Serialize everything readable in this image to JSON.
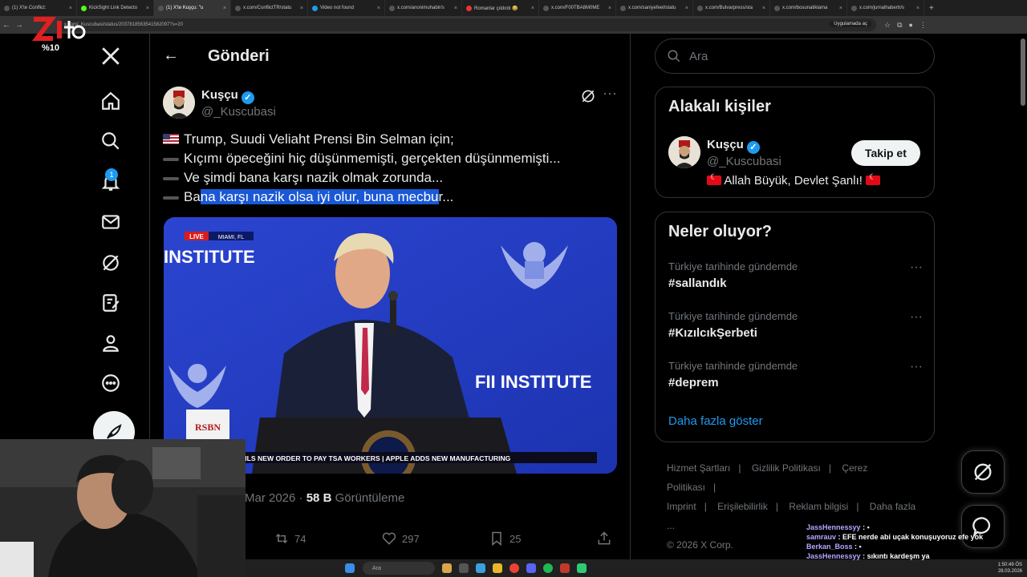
{
  "browser": {
    "tabs": [
      {
        "label": "(1) X'te Conflict:",
        "color": "#555",
        "active": false
      },
      {
        "label": "KickSight Link Detecto",
        "color": "#53fc18",
        "active": false
      },
      {
        "label": "(1) X'te Kuşçu: \"u",
        "color": "#555",
        "active": true
      },
      {
        "label": "x.com/ConflictTR/statu",
        "color": "#555",
        "active": false
      },
      {
        "label": "Video not found",
        "color": "#1d9bf0",
        "active": false
      },
      {
        "label": "x.com/anonimuhabir/s",
        "color": "#555",
        "active": false
      },
      {
        "label": "Romanlar çıldırdı 😂",
        "color": "#e33",
        "active": false
      },
      {
        "label": "x.com/F00TBA8M0ME",
        "color": "#555",
        "active": false
      },
      {
        "label": "x.com/saniyefeel/statu",
        "color": "#555",
        "active": false
      },
      {
        "label": "x.com/Bulvarpress/sta",
        "color": "#555",
        "active": false
      },
      {
        "label": "x.com/bosunatiklama",
        "color": "#555",
        "active": false
      },
      {
        "label": "x.com/jurnalhabertr/s",
        "color": "#555",
        "active": false
      }
    ],
    "url": "x.com/_Kuscubasi/status/2037818563541582097?s=20",
    "open_in_app": "Uygulamada aç"
  },
  "overlay": {
    "logo_text": "%10"
  },
  "nav": {
    "badge_count": "1"
  },
  "header": {
    "title": "Gönderi"
  },
  "tweet": {
    "author_name": "Kuşçu",
    "author_handle": "@_Kuscubasi",
    "lines": [
      "Trump, Suudi Veliaht Prensi Bin Selman için;",
      "Kıçımı öpeceğini hiç düşünmemişti, gerçekten düşünmemişti...",
      "Ve şimdi bana karşı nazik olmak zorunda...",
      "Bana karşı nazik olsa iyi olur, buna mecbur..."
    ],
    "last_line_plain_start": "Ba",
    "last_line_highlight": "na karşı nazik olsa iyi olur, buna mecbu",
    "last_line_plain_end": "r...",
    "date_partial": "Mar 2026 ·",
    "views_count": "58 B",
    "views_label": "Görüntüleme",
    "retweets": "74",
    "likes": "297",
    "bookmarks": "25",
    "media": {
      "live_tag": "LIVE",
      "location": "MIAMI, FL",
      "logo_left": "INSTITUTE",
      "logo_right": "FII INSTITUTE",
      "rsbn": "RSBN",
      "ticker": "ESIDENT TRUMP UNVEILS NEW ORDER TO PAY TSA WORKERS | APPLE ADDS NEW MANUFACTURING"
    }
  },
  "sidebar": {
    "search_placeholder": "Ara",
    "relevant": {
      "title": "Alakalı kişiler",
      "name": "Kuşçu",
      "handle": "@_Kuscubasi",
      "bio": "Allah Büyük, Devlet Şanlı!",
      "follow_label": "Takip et"
    },
    "trends": {
      "title": "Neler oluyor?",
      "items": [
        {
          "context": "Türkiye tarihinde gündemde",
          "tag": "#sallandık"
        },
        {
          "context": "Türkiye tarihinde gündemde",
          "tag": "#KızılcıkŞerbeti"
        },
        {
          "context": "Türkiye tarihinde gündemde",
          "tag": "#deprem"
        }
      ],
      "more": "Daha fazla göster"
    },
    "footer": [
      "Hizmet Şartları",
      "Gizlilik Politikası",
      "Çerez Politikası",
      "Imprint",
      "Erişilebilirlik",
      "Reklam bilgisi",
      "Daha fazla ...",
      "© 2026 X Corp."
    ]
  },
  "chat": [
    {
      "user": "JassHennessyy",
      "msg": ""
    },
    {
      "user": "samrauv",
      "msg": "EFE nerde abi uçak konuşuyoruz efe yok"
    },
    {
      "user": "Berkan_Boss",
      "msg": ""
    },
    {
      "user": "JassHennessyy",
      "msg": "sıkıntı kardeşm ya"
    }
  ],
  "taskbar": {
    "search": "Ara",
    "time": "1:50:49 ÖS",
    "date": "28.03.2026"
  }
}
